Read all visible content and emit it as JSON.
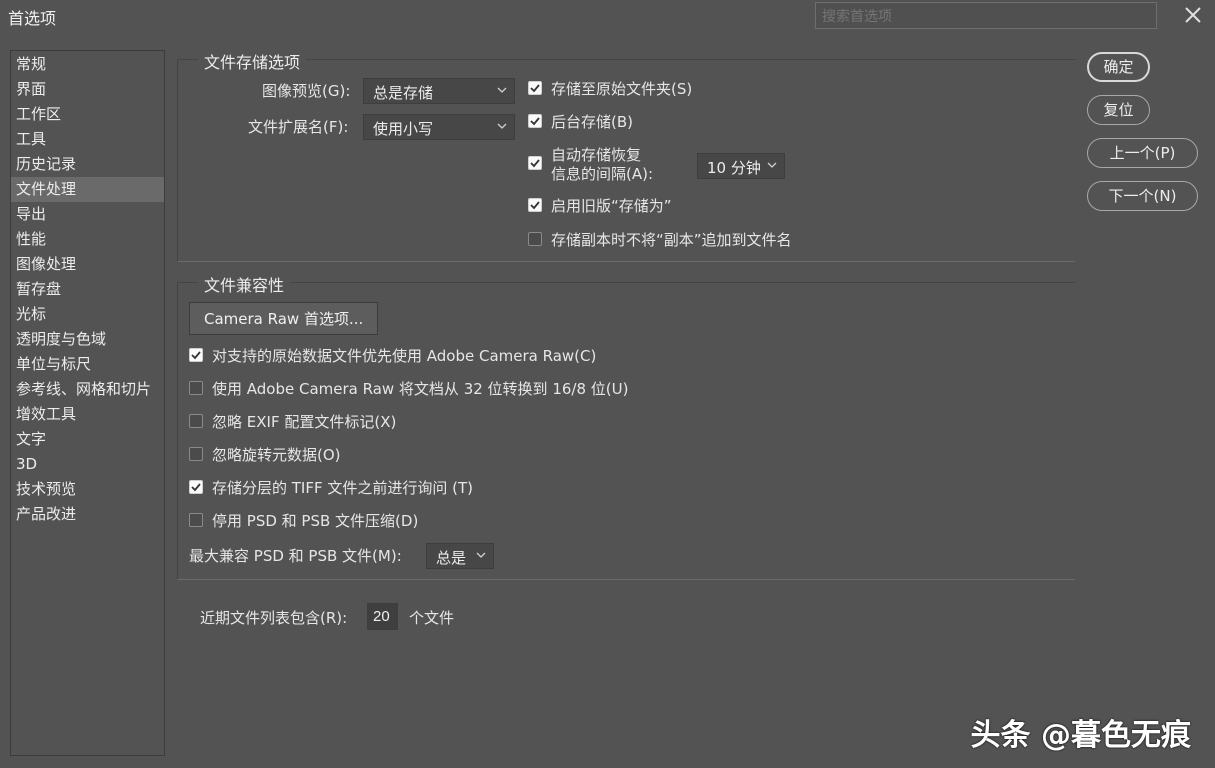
{
  "window": {
    "title": "首选项"
  },
  "search": {
    "placeholder": "搜索首选项"
  },
  "sidebar": {
    "items": [
      "常规",
      "界面",
      "工作区",
      "工具",
      "历史记录",
      "文件处理",
      "导出",
      "性能",
      "图像处理",
      "暂存盘",
      "光标",
      "透明度与色域",
      "单位与标尺",
      "参考线、网格和切片",
      "增效工具",
      "文字",
      "3D",
      "技术预览",
      "产品改进"
    ],
    "selected": "文件处理"
  },
  "file_saving": {
    "legend": "文件存储选项",
    "image_preview_label": "图像预览(G):",
    "image_preview_value": "总是存储",
    "extension_label": "文件扩展名(F):",
    "extension_value": "使用小写",
    "save_original_folder": {
      "label": "存储至原始文件夹(S)",
      "checked": true
    },
    "save_background": {
      "label": "后台存储(B)",
      "checked": true
    },
    "auto_save_line1": "自动存储恢复",
    "auto_save_line2": "信息的间隔(A):",
    "auto_save_checked": true,
    "auto_save_interval": "10 分钟",
    "legacy_save_as": {
      "label": "启用旧版“存储为”",
      "checked": true
    },
    "no_copy_suffix": {
      "label": "存储副本时不将“副本”追加到文件名",
      "checked": false
    }
  },
  "compatibility": {
    "legend": "文件兼容性",
    "camera_raw_button": "Camera Raw 首选项...",
    "options": [
      {
        "label": "对支持的原始数据文件优先使用 Adobe Camera Raw(C)",
        "checked": true
      },
      {
        "label": "使用 Adobe Camera Raw 将文档从 32 位转换到 16/8 位(U)",
        "checked": false
      },
      {
        "label": "忽略 EXIF 配置文件标记(X)",
        "checked": false
      },
      {
        "label": "忽略旋转元数据(O)",
        "checked": false
      },
      {
        "label": "存储分层的 TIFF 文件之前进行询问  (T)",
        "checked": true
      },
      {
        "label": "停用 PSD 和 PSB 文件压缩(D)",
        "checked": false
      }
    ],
    "max_compat_label": "最大兼容 PSD 和 PSB 文件(M):",
    "max_compat_value": "总是"
  },
  "recent_files": {
    "label": "近期文件列表包含(R):",
    "value": "20",
    "suffix": "个文件"
  },
  "buttons": {
    "ok": "确定",
    "reset": "复位",
    "prev": "上一个(P)",
    "next": "下一个(N)"
  },
  "watermark": "头条 @暮色无痕",
  "icons": {
    "checkbox_checked": "check-icon",
    "dropdown": "chevron-down-icon",
    "close": "close-icon"
  }
}
